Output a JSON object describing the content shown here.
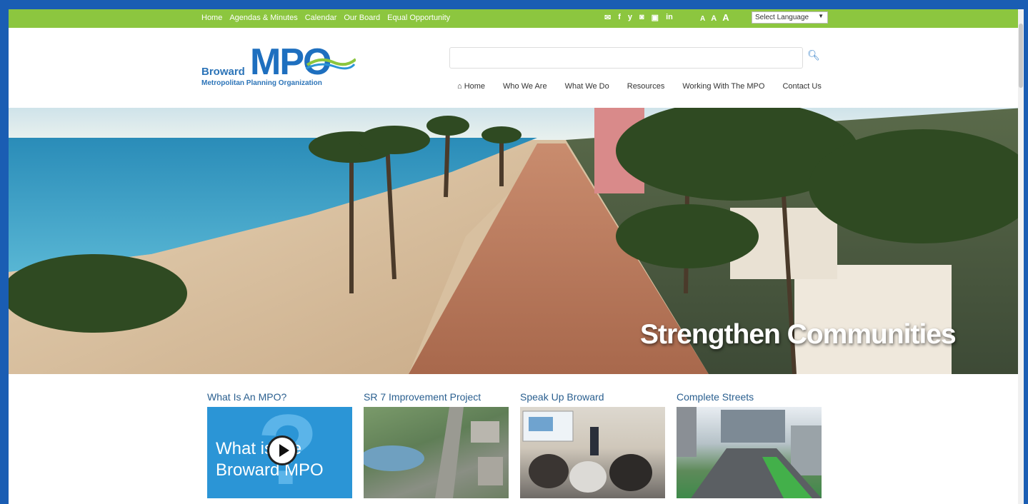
{
  "topbar": {
    "nav": [
      "Home",
      "Agendas & Minutes",
      "Calendar",
      "Our Board",
      "Equal Opportunity"
    ],
    "social_icons": [
      "email-icon",
      "facebook-icon",
      "twitter-icon",
      "instagram-icon",
      "youtube-icon",
      "linkedin-icon"
    ],
    "social_glyphs": [
      "✉",
      "f",
      "y",
      "◙",
      "▣",
      "in"
    ],
    "text_size": [
      "A",
      "A",
      "A"
    ],
    "language_select": "Select Language"
  },
  "logo": {
    "broward": "Broward",
    "mpo": "MPO",
    "subtitle": "Metropolitan Planning Organization"
  },
  "search": {
    "value": ""
  },
  "mainnav": {
    "home": "Home",
    "items": [
      "Who We Are",
      "What We Do",
      "Resources",
      "Working With The MPO",
      "Contact Us"
    ]
  },
  "hero": {
    "caption": "Strengthen Communities"
  },
  "cards": [
    {
      "title": "What Is An MPO?",
      "video_text_1": "What is the",
      "video_text_2": "Broward MPO"
    },
    {
      "title": "SR 7 Improvement Project"
    },
    {
      "title": "Speak Up Broward"
    },
    {
      "title": "Complete Streets"
    }
  ],
  "colors": {
    "frame": "#1a5db3",
    "topbar": "#8cc63f",
    "brand_blue": "#1e6fbf"
  }
}
